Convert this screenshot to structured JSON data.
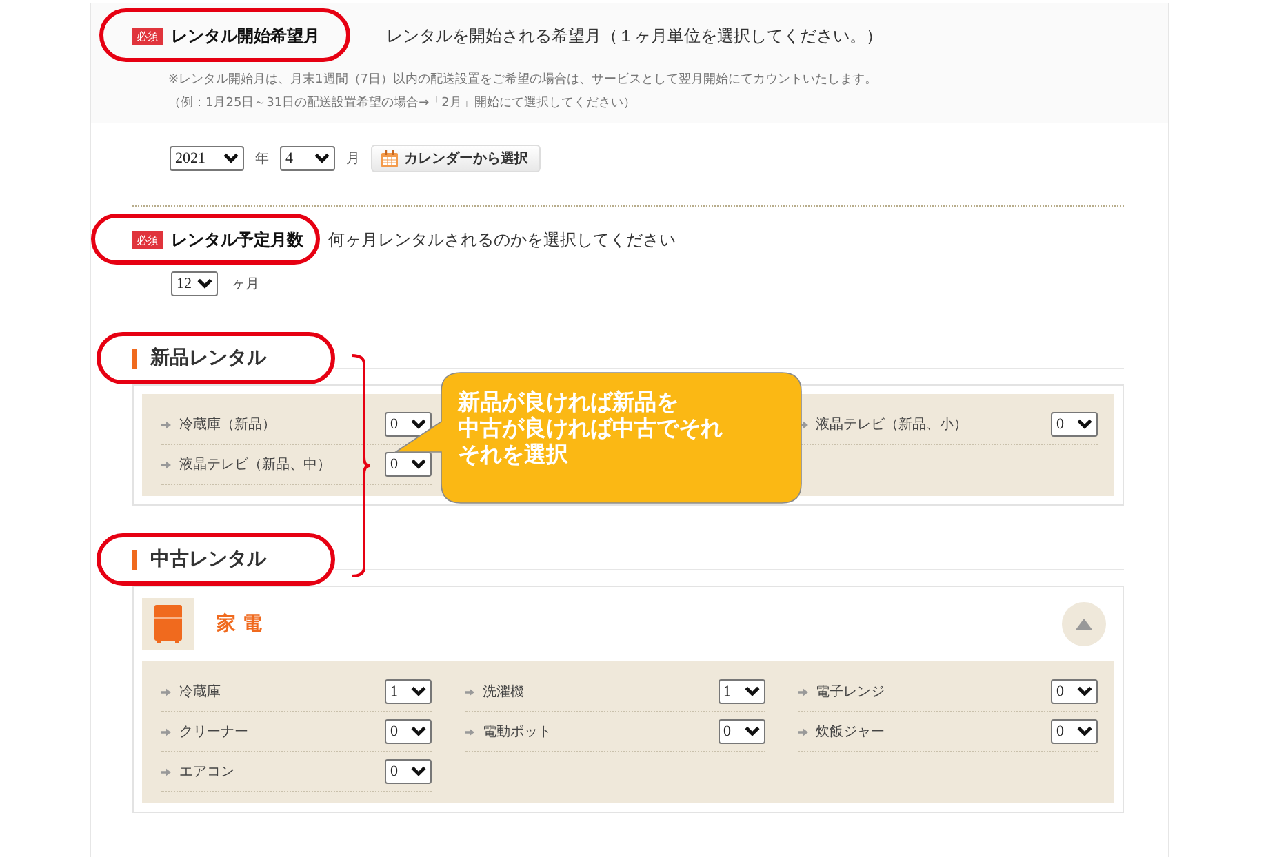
{
  "start_month": {
    "required_badge": "必須",
    "label": "レンタル開始希望月",
    "description": "レンタルを開始される希望月（１ヶ月単位を選択してください。）",
    "notes": [
      "※レンタル開始月は、月末1週間（7日）以内の配送設置をご希望の場合は、サービスとして翌月開始にてカウントいたします。",
      "（例：1月25日～31日の配送設置希望の場合→「2月」開始にて選択してください）"
    ],
    "year": "2021",
    "year_unit": "年",
    "month": "4",
    "month_unit": "月",
    "calendar_button": "カレンダーから選択"
  },
  "duration": {
    "required_badge": "必須",
    "label": "レンタル予定月数",
    "description": "何ヶ月レンタルされるのかを選択してください",
    "months": "12",
    "unit": "ヶ月"
  },
  "new_rental": {
    "title": "新品レンタル",
    "columns": [
      [
        {
          "name": "冷蔵庫（新品）",
          "quantity": "0"
        },
        {
          "name": "液晶テレビ（新品、中）",
          "quantity": "0"
        }
      ],
      [
        {
          "name": "液晶テレビ（新品、小）",
          "quantity": "0"
        }
      ]
    ]
  },
  "used_rental": {
    "title": "中古レンタル",
    "category": {
      "title": "家 電",
      "expanded": true,
      "items": [
        {
          "name": "冷蔵庫",
          "quantity": "1"
        },
        {
          "name": "洗濯機",
          "quantity": "1"
        },
        {
          "name": "電子レンジ",
          "quantity": "0"
        },
        {
          "name": "クリーナー",
          "quantity": "0"
        },
        {
          "name": "電動ポット",
          "quantity": "0"
        },
        {
          "name": "炊飯ジャー",
          "quantity": "0"
        },
        {
          "name": "エアコン",
          "quantity": "0"
        }
      ]
    }
  },
  "annotation": {
    "callout_lines": [
      "新品が良ければ新品を",
      "中古が良ければ中古でそれ",
      "それを選択"
    ]
  }
}
